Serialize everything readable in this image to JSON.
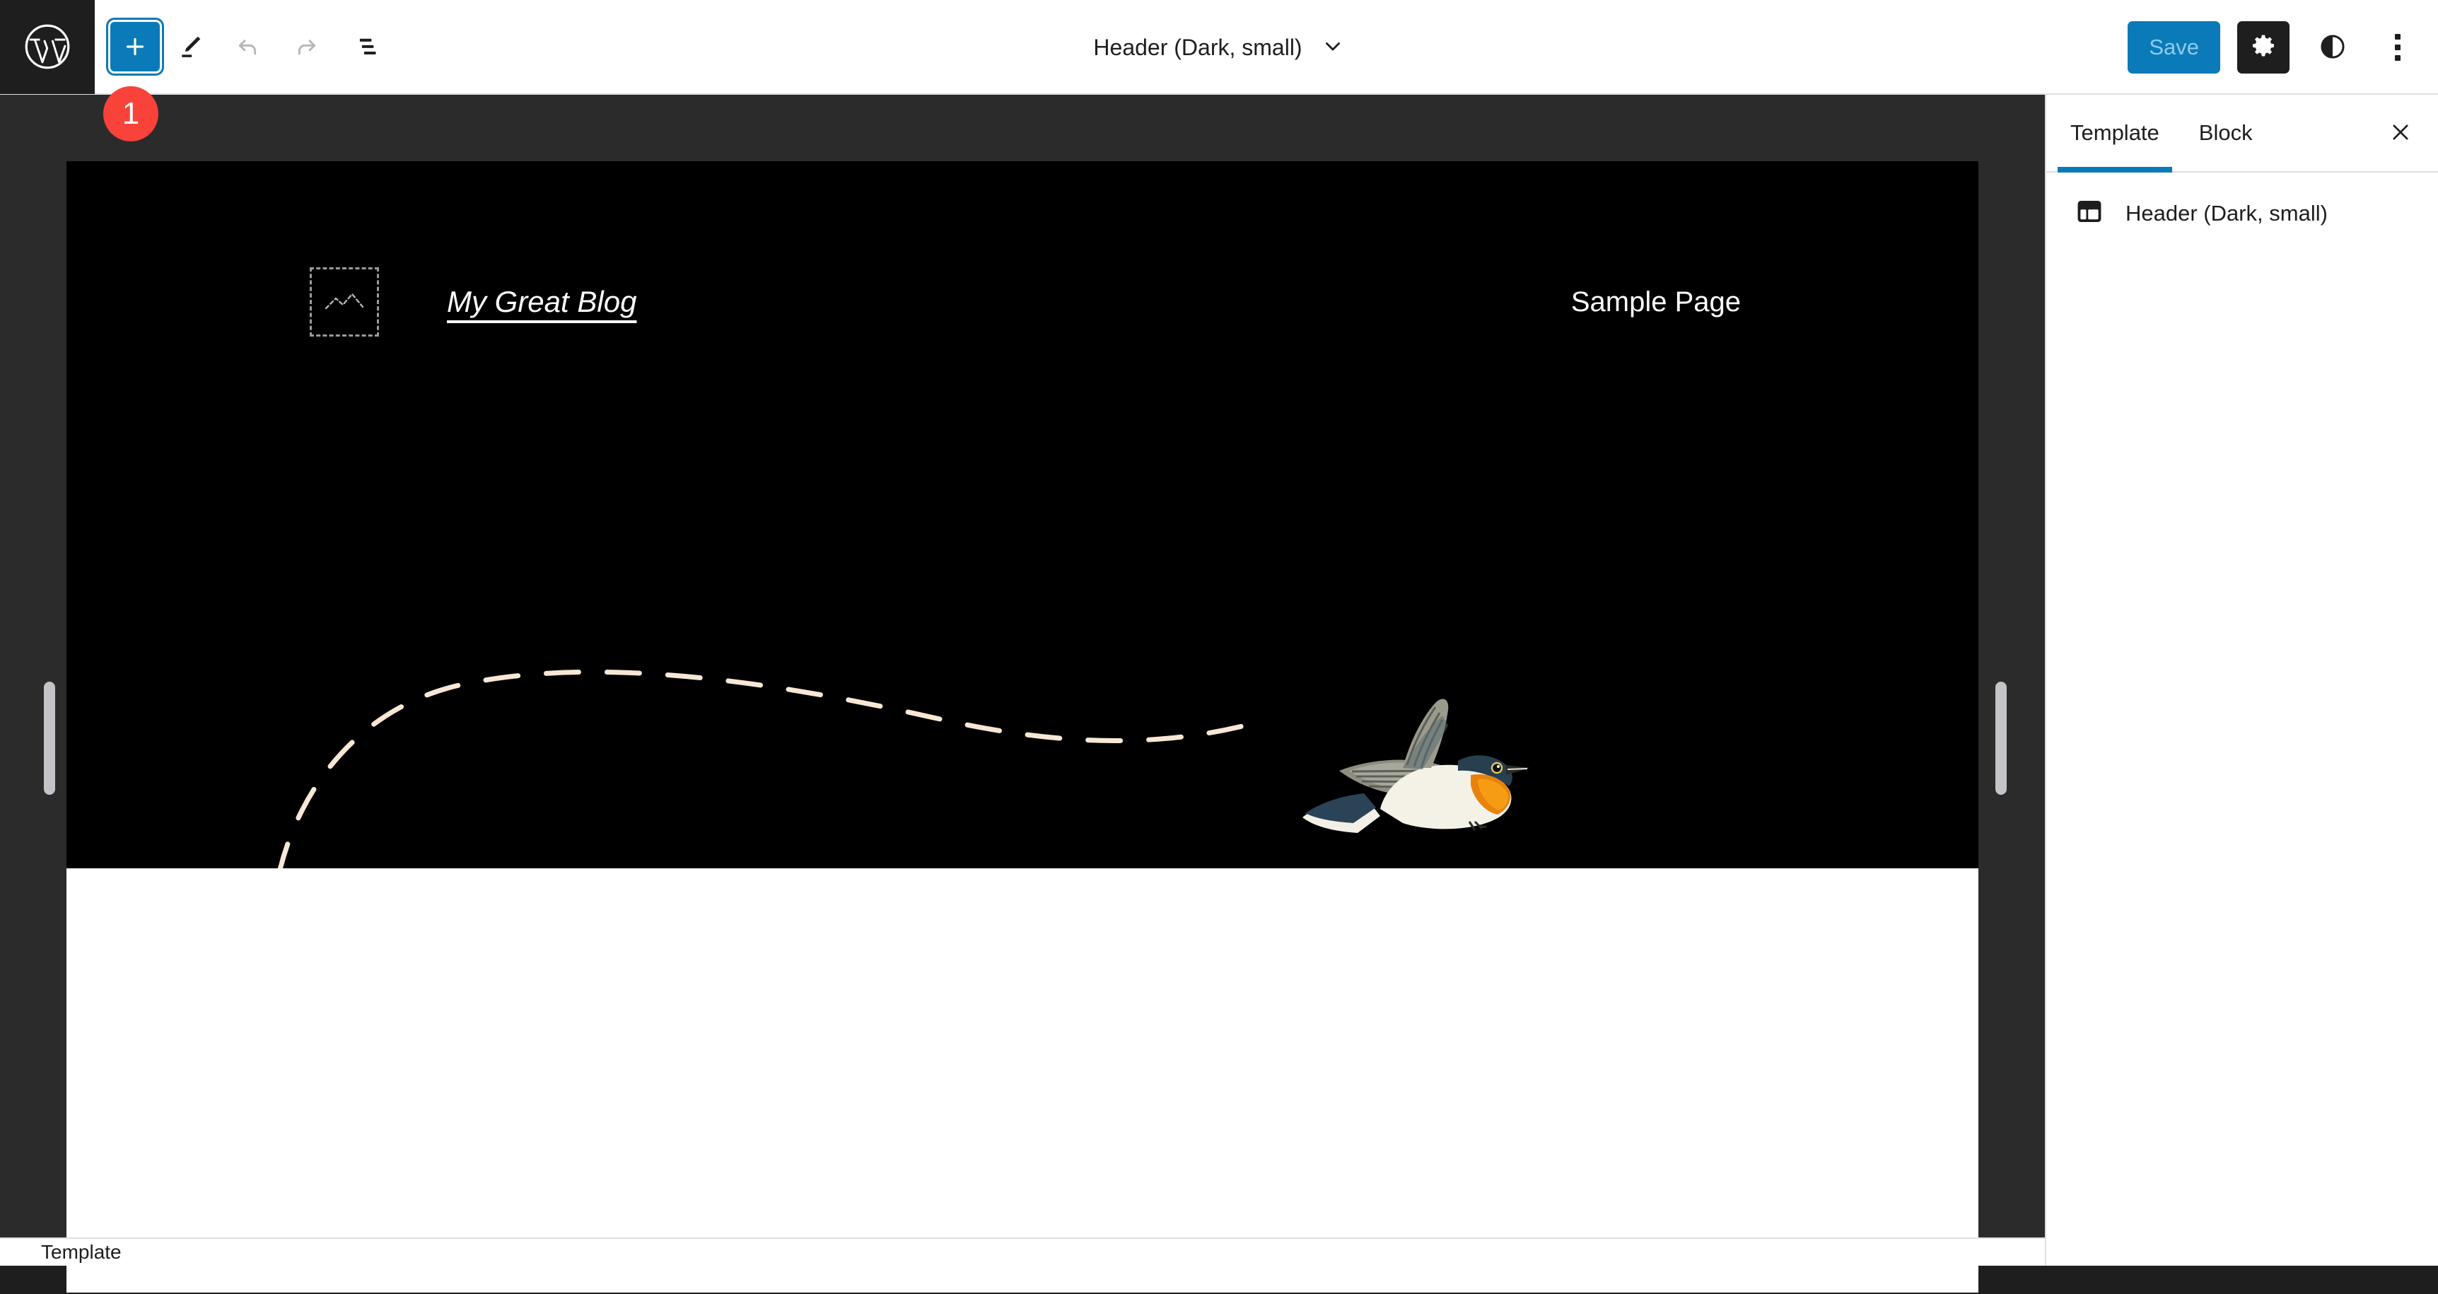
{
  "topbar": {
    "logo_icon": "wordpress-logo-icon",
    "tools": [
      {
        "name": "add-block-button",
        "icon": "plus-icon",
        "label": "Add block",
        "state": "primary"
      },
      {
        "name": "edit-tool-button",
        "icon": "pencil-icon",
        "label": "Edit",
        "state": "normal"
      },
      {
        "name": "undo-button",
        "icon": "undo-icon",
        "label": "Undo",
        "state": "disabled"
      },
      {
        "name": "redo-button",
        "icon": "redo-icon",
        "label": "Redo",
        "state": "disabled"
      },
      {
        "name": "list-view-button",
        "icon": "list-view-icon",
        "label": "Document Overview",
        "state": "normal"
      }
    ],
    "document_title": "Header (Dark, small)",
    "document_title_chevron": "chevron-down-icon",
    "save_label": "Save",
    "save_enabled": false,
    "settings_icon": "gear-icon",
    "styles_icon": "contrast-half-circle-icon",
    "options_icon": "kebab-vertical-icon",
    "accent_color": "#0b7ab8",
    "save_text_color": "#8fcbec"
  },
  "annotation": {
    "badge_number": "1",
    "badge_color": "#f9423a"
  },
  "canvas": {
    "header_bg": "#000000",
    "body_bg": "#ffffff",
    "logo_placeholder_icon": "image-placeholder-icon",
    "site_title": "My Great Blog",
    "nav": [
      {
        "label": "Sample Page"
      }
    ],
    "illustration": {
      "name": "flying-bird-illustration",
      "path_name": "dashed-flight-path",
      "path_color": "#f7e7d4"
    }
  },
  "resize": {
    "left_handle": "resize-handle-left",
    "right_handle": "resize-handle-right"
  },
  "sidebar": {
    "tabs": [
      {
        "label": "Template",
        "active": true
      },
      {
        "label": "Block",
        "active": false
      }
    ],
    "close_icon": "close-icon",
    "item": {
      "icon": "template-part-icon",
      "label": "Header (Dark, small)"
    }
  },
  "footer": {
    "breadcrumb": "Template"
  }
}
